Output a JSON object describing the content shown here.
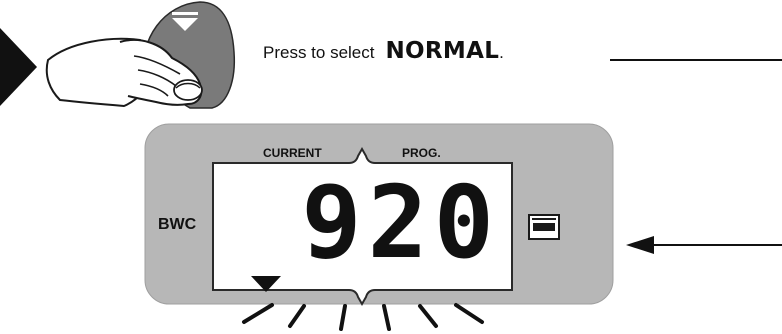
{
  "instruction": {
    "prefix": "Press to select",
    "mode": "NORMAL",
    "suffix": "."
  },
  "display": {
    "label_current": "CURRENT",
    "label_prog": "PROG.",
    "value": "920",
    "left_label": "BWC",
    "right_icon": "rem-icon"
  },
  "colors": {
    "panel": "#b7b7b7",
    "screen": "#ffffff",
    "ink": "#111111"
  },
  "icons": {
    "pointer": "arrow-right-icon",
    "hand": "hand-press-button-icon",
    "button_symbol": "down-triangle-bar-icon",
    "indicator": "triangle-down-icon"
  }
}
